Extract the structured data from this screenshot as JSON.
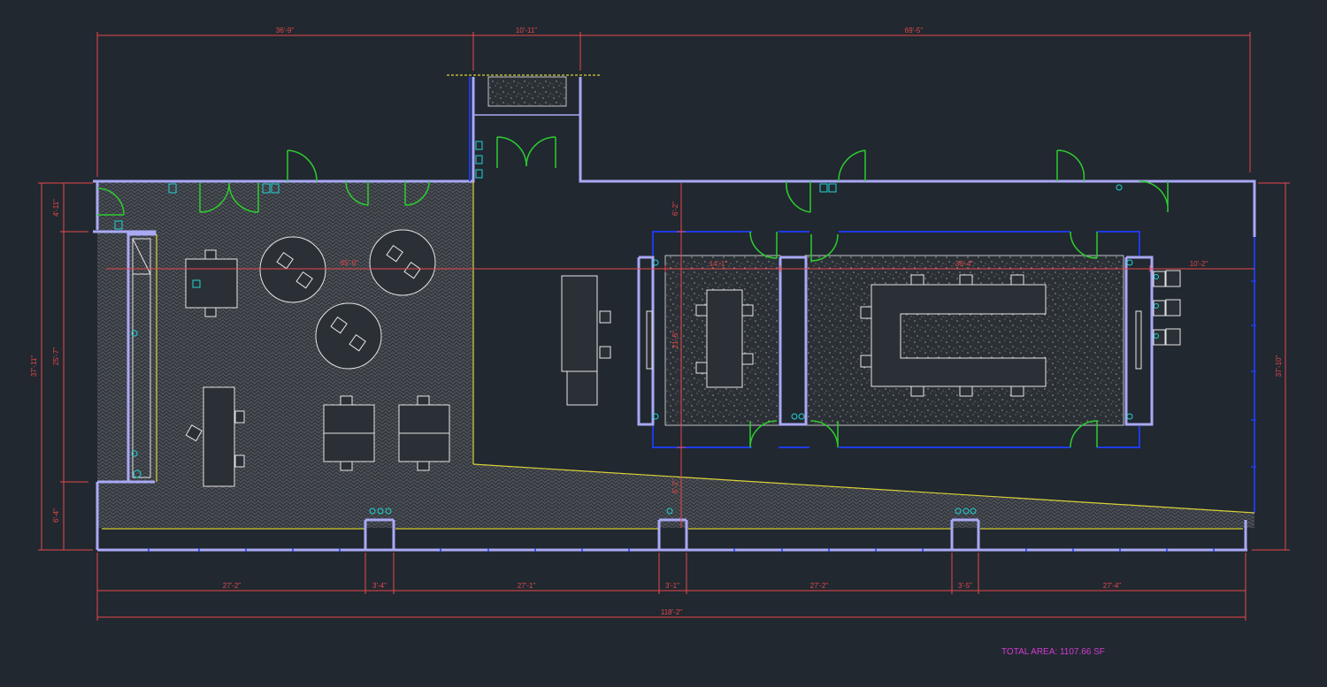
{
  "dimensions": {
    "top_left": "36'-9\"",
    "top_mid": "10'-11\"",
    "top_right": "69'-5\"",
    "left_top": "4'-11\"",
    "left_mid": "25'-7\"",
    "left_bottom": "6'-4\"",
    "left_total": "37'-11\"",
    "right_total": "37'-10\"",
    "inner_span": "65'-0\"",
    "inner_left": "14'-1\"",
    "inner_mid": "36'-4\"",
    "inner_right": "10'-2\"",
    "vertical_a": "6'-2\"",
    "vertical_b": "21'-6\"",
    "vertical_c": "6'-2\"",
    "bottom_1": "27'-2\"",
    "bottom_2": "3'-4\"",
    "bottom_3": "27'-1\"",
    "bottom_4": "3'-1\"",
    "bottom_5": "27'-2\"",
    "bottom_6": "3'-5\"",
    "bottom_7": "27'-4\"",
    "bottom_total": "118'-2\""
  },
  "total_area": "TOTAL AREA: 1107.66 SF",
  "colors": {
    "background": "#212830",
    "wall": "#a9a9f5",
    "glass_wall": "#1d3be6",
    "dimension": "#e8474a",
    "door": "#2ecc2e",
    "fixture": "#22d3d3",
    "furniture": "#e5e5e5",
    "window": "#d9d23a",
    "area_label": "#d33bd3"
  }
}
